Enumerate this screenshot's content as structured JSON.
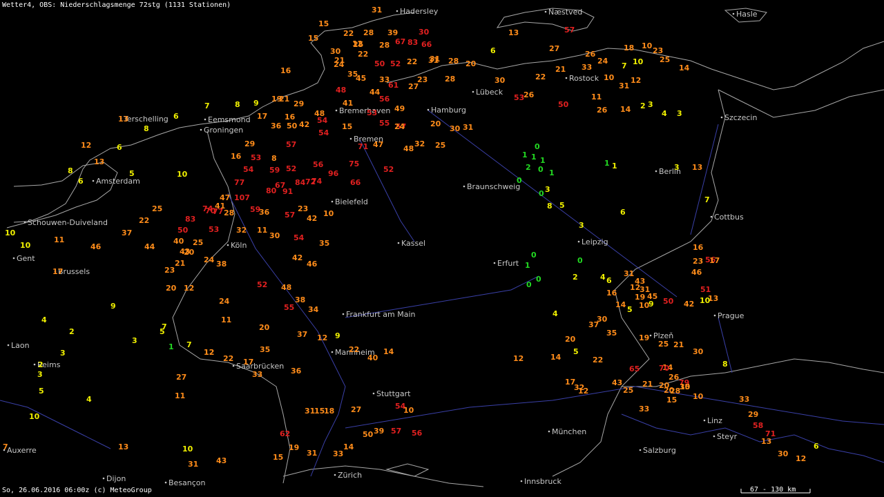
{
  "header": {
    "title": "Wetter4, OBS: Niederschlagsmenge 72stg (1131 Stationen)"
  },
  "footer": {
    "caption": "So, 26.06.2016 06:00z (c) MeteoGroup",
    "scale": "67 - 130 km"
  },
  "colors": {
    "background": "#000000",
    "borders": "#a8a8a8",
    "rivers": "#3a40a8",
    "city_label": "#c8c8c8",
    "class_green": "#22d822",
    "class_yellow": "#f0f000",
    "class_orange": "#ff8c1a",
    "class_red": "#e02020"
  },
  "cities": [
    {
      "name": "Hadersley"
    },
    {
      "name": "Næstved"
    },
    {
      "name": "Hasle"
    },
    {
      "name": "Rostock"
    },
    {
      "name": "Lübeck"
    },
    {
      "name": "Hamburg"
    },
    {
      "name": "Bremerhaven"
    },
    {
      "name": "Bremen"
    },
    {
      "name": "Szczecin"
    },
    {
      "name": "Terschelling"
    },
    {
      "name": "Eemsmond"
    },
    {
      "name": "Groningen"
    },
    {
      "name": "Amsterdam"
    },
    {
      "name": "Berlin"
    },
    {
      "name": "Braunschweig"
    },
    {
      "name": "Bielefeld"
    },
    {
      "name": "Schouwen-Duiveland"
    },
    {
      "name": "Cottbus"
    },
    {
      "name": "Kassel"
    },
    {
      "name": "Leipzig"
    },
    {
      "name": "Köln"
    },
    {
      "name": "Gent"
    },
    {
      "name": "Brussels"
    },
    {
      "name": "Erfurt"
    },
    {
      "name": "Frankfurt am Main"
    },
    {
      "name": "Prague"
    },
    {
      "name": "Laon"
    },
    {
      "name": "Plzeň"
    },
    {
      "name": "Mannheim"
    },
    {
      "name": "Saarbrücken"
    },
    {
      "name": "Reims"
    },
    {
      "name": "Stuttgart"
    },
    {
      "name": "Linz"
    },
    {
      "name": "München"
    },
    {
      "name": "Steyr"
    },
    {
      "name": "Auxerre"
    },
    {
      "name": "Salzburg"
    },
    {
      "name": "Dijon"
    },
    {
      "name": "Besançon"
    },
    {
      "name": "Zürich"
    },
    {
      "name": "Innsbruck"
    }
  ],
  "observations": [
    {
      "v": "31",
      "c": "o"
    },
    {
      "v": "15",
      "c": "o"
    },
    {
      "v": "22",
      "c": "o"
    },
    {
      "v": "28",
      "c": "o"
    },
    {
      "v": "39",
      "c": "o"
    },
    {
      "v": "30",
      "c": "r"
    },
    {
      "v": "57",
      "c": "r"
    },
    {
      "v": "13",
      "c": "o"
    },
    {
      "v": "15",
      "c": "o"
    },
    {
      "v": "12",
      "c": "o"
    },
    {
      "v": "25",
      "c": "o"
    },
    {
      "v": "28",
      "c": "o"
    },
    {
      "v": "67",
      "c": "r"
    },
    {
      "v": "83",
      "c": "r"
    },
    {
      "v": "66",
      "c": "r"
    },
    {
      "v": "27",
      "c": "o"
    },
    {
      "v": "30",
      "c": "o"
    },
    {
      "v": "21",
      "c": "o"
    },
    {
      "v": "22",
      "c": "o"
    },
    {
      "v": "26",
      "c": "o"
    },
    {
      "v": "18",
      "c": "o"
    },
    {
      "v": "10",
      "c": "o"
    },
    {
      "v": "23",
      "c": "o"
    },
    {
      "v": "6",
      "c": "y"
    },
    {
      "v": "24",
      "c": "o"
    },
    {
      "v": "31",
      "c": "o"
    },
    {
      "v": "50",
      "c": "r"
    },
    {
      "v": "52",
      "c": "r"
    },
    {
      "v": "22",
      "c": "o"
    },
    {
      "v": "31",
      "c": "o"
    },
    {
      "v": "28",
      "c": "o"
    },
    {
      "v": "20",
      "c": "o"
    },
    {
      "v": "16",
      "c": "o"
    },
    {
      "v": "35",
      "c": "o"
    },
    {
      "v": "45",
      "c": "o"
    },
    {
      "v": "33",
      "c": "o"
    },
    {
      "v": "61",
      "c": "r"
    },
    {
      "v": "27",
      "c": "o"
    },
    {
      "v": "23",
      "c": "o"
    },
    {
      "v": "28",
      "c": "o"
    },
    {
      "v": "30",
      "c": "o"
    },
    {
      "v": "22",
      "c": "o"
    },
    {
      "v": "21",
      "c": "o"
    },
    {
      "v": "33",
      "c": "o"
    },
    {
      "v": "24",
      "c": "o"
    },
    {
      "v": "7",
      "c": "y"
    },
    {
      "v": "10",
      "c": "y"
    },
    {
      "v": "25",
      "c": "o"
    },
    {
      "v": "14",
      "c": "o"
    },
    {
      "v": "48",
      "c": "r"
    },
    {
      "v": "44",
      "c": "o"
    },
    {
      "v": "56",
      "c": "r"
    },
    {
      "v": "53",
      "c": "r"
    },
    {
      "v": "26",
      "c": "o"
    },
    {
      "v": "50",
      "c": "r"
    },
    {
      "v": "10",
      "c": "o"
    },
    {
      "v": "31",
      "c": "o"
    },
    {
      "v": "12",
      "c": "o"
    },
    {
      "v": "7",
      "c": "y"
    },
    {
      "v": "8",
      "c": "y"
    },
    {
      "v": "9",
      "c": "y"
    },
    {
      "v": "19",
      "c": "o"
    },
    {
      "v": "21",
      "c": "o"
    },
    {
      "v": "29",
      "c": "o"
    },
    {
      "v": "48",
      "c": "o"
    },
    {
      "v": "41",
      "c": "o"
    },
    {
      "v": "49",
      "c": "o"
    },
    {
      "v": "11",
      "c": "o"
    },
    {
      "v": "26",
      "c": "o"
    },
    {
      "v": "14",
      "c": "o"
    },
    {
      "v": "2",
      "c": "y"
    },
    {
      "v": "3",
      "c": "y"
    },
    {
      "v": "4",
      "c": "y"
    },
    {
      "v": "3",
      "c": "y"
    },
    {
      "v": "13",
      "c": "o"
    },
    {
      "v": "6",
      "c": "y"
    },
    {
      "v": "17",
      "c": "o"
    },
    {
      "v": "16",
      "c": "o"
    },
    {
      "v": "54",
      "c": "r"
    },
    {
      "v": "53",
      "c": "r"
    },
    {
      "v": "55",
      "c": "r"
    },
    {
      "v": "57",
      "c": "r"
    },
    {
      "v": "8",
      "c": "y"
    },
    {
      "v": "36",
      "c": "o"
    },
    {
      "v": "50",
      "c": "o"
    },
    {
      "v": "42",
      "c": "o"
    },
    {
      "v": "15",
      "c": "o"
    },
    {
      "v": "24",
      "c": "o"
    },
    {
      "v": "20",
      "c": "o"
    },
    {
      "v": "30",
      "c": "o"
    },
    {
      "v": "31",
      "c": "o"
    },
    {
      "v": "12",
      "c": "o"
    },
    {
      "v": "29",
      "c": "o"
    },
    {
      "v": "57",
      "c": "r"
    },
    {
      "v": "54",
      "c": "r"
    },
    {
      "v": "71",
      "c": "r"
    },
    {
      "v": "47",
      "c": "o"
    },
    {
      "v": "48",
      "c": "o"
    },
    {
      "v": "32",
      "c": "o"
    },
    {
      "v": "25",
      "c": "o"
    },
    {
      "v": "6",
      "c": "y"
    },
    {
      "v": "13",
      "c": "o"
    },
    {
      "v": "53",
      "c": "r"
    },
    {
      "v": "16",
      "c": "o"
    },
    {
      "v": "8",
      "c": "o"
    },
    {
      "v": "56",
      "c": "r"
    },
    {
      "v": "75",
      "c": "r"
    },
    {
      "v": "52",
      "c": "r"
    },
    {
      "v": "8",
      "c": "y"
    },
    {
      "v": "6",
      "c": "y"
    },
    {
      "v": "5",
      "c": "y"
    },
    {
      "v": "54",
      "c": "r"
    },
    {
      "v": "59",
      "c": "r"
    },
    {
      "v": "52",
      "c": "r"
    },
    {
      "v": "74",
      "c": "r"
    },
    {
      "v": "96",
      "c": "r"
    },
    {
      "v": "10",
      "c": "y"
    },
    {
      "v": "77",
      "c": "r"
    },
    {
      "v": "67",
      "c": "r"
    },
    {
      "v": "84",
      "c": "r"
    },
    {
      "v": "72",
      "c": "r"
    },
    {
      "v": "66",
      "c": "r"
    },
    {
      "v": "0",
      "c": "g"
    },
    {
      "v": "1",
      "c": "g"
    },
    {
      "v": "1",
      "c": "g"
    },
    {
      "v": "2",
      "c": "g"
    },
    {
      "v": "0",
      "c": "g"
    },
    {
      "v": "0",
      "c": "g"
    },
    {
      "v": "1",
      "c": "g"
    },
    {
      "v": "1",
      "c": "y"
    },
    {
      "v": "3",
      "c": "y"
    },
    {
      "v": "13",
      "c": "o"
    },
    {
      "v": "7",
      "c": "y"
    },
    {
      "v": "47",
      "c": "o"
    },
    {
      "v": "107",
      "c": "r"
    },
    {
      "v": "80",
      "c": "r"
    },
    {
      "v": "91",
      "c": "r"
    },
    {
      "v": "25",
      "c": "o"
    },
    {
      "v": "74",
      "c": "r"
    },
    {
      "v": "77",
      "c": "r"
    },
    {
      "v": "59",
      "c": "r"
    },
    {
      "v": "36",
      "c": "o"
    },
    {
      "v": "41",
      "c": "o"
    },
    {
      "v": "23",
      "c": "o"
    },
    {
      "v": "22",
      "c": "o"
    },
    {
      "v": "83",
      "c": "r"
    },
    {
      "v": "70",
      "c": "r"
    },
    {
      "v": "28",
      "c": "o"
    },
    {
      "v": "57",
      "c": "r"
    },
    {
      "v": "42",
      "c": "o"
    },
    {
      "v": "10",
      "c": "o"
    },
    {
      "v": "10",
      "c": "y"
    },
    {
      "v": "11",
      "c": "o"
    },
    {
      "v": "37",
      "c": "o"
    },
    {
      "v": "50",
      "c": "r"
    },
    {
      "v": "53",
      "c": "r"
    },
    {
      "v": "32",
      "c": "o"
    },
    {
      "v": "11",
      "c": "o"
    },
    {
      "v": "30",
      "c": "o"
    },
    {
      "v": "10",
      "c": "y"
    },
    {
      "v": "46",
      "c": "o"
    },
    {
      "v": "44",
      "c": "o"
    },
    {
      "v": "40",
      "c": "o"
    },
    {
      "v": "43",
      "c": "o"
    },
    {
      "v": "25",
      "c": "o"
    },
    {
      "v": "54",
      "c": "r"
    },
    {
      "v": "35",
      "c": "o"
    },
    {
      "v": "17",
      "c": "o"
    },
    {
      "v": "23",
      "c": "o"
    },
    {
      "v": "21",
      "c": "o"
    },
    {
      "v": "20",
      "c": "o"
    },
    {
      "v": "24",
      "c": "o"
    },
    {
      "v": "38",
      "c": "o"
    },
    {
      "v": "42",
      "c": "o"
    },
    {
      "v": "46",
      "c": "o"
    },
    {
      "v": "20",
      "c": "o"
    },
    {
      "v": "12",
      "c": "o"
    },
    {
      "v": "52",
      "c": "r"
    },
    {
      "v": "24",
      "c": "o"
    },
    {
      "v": "48",
      "c": "o"
    },
    {
      "v": "38",
      "c": "o"
    },
    {
      "v": "34",
      "c": "o"
    },
    {
      "v": "55",
      "c": "r"
    },
    {
      "v": "4",
      "c": "y"
    },
    {
      "v": "9",
      "c": "y"
    },
    {
      "v": "11",
      "c": "o"
    },
    {
      "v": "20",
      "c": "o"
    },
    {
      "v": "35",
      "c": "o"
    },
    {
      "v": "37",
      "c": "o"
    },
    {
      "v": "12",
      "c": "o"
    },
    {
      "v": "2",
      "c": "y"
    },
    {
      "v": "3",
      "c": "y"
    },
    {
      "v": "7",
      "c": "y"
    },
    {
      "v": "1",
      "c": "g"
    },
    {
      "v": "7",
      "c": "y"
    },
    {
      "v": "12",
      "c": "o"
    },
    {
      "v": "22",
      "c": "o"
    },
    {
      "v": "17",
      "c": "o"
    },
    {
      "v": "3",
      "c": "y"
    },
    {
      "v": "2",
      "c": "y"
    },
    {
      "v": "3",
      "c": "y"
    },
    {
      "v": "5",
      "c": "y"
    },
    {
      "v": "27",
      "c": "o"
    },
    {
      "v": "11",
      "c": "o"
    },
    {
      "v": "33",
      "c": "o"
    },
    {
      "v": "36",
      "c": "o"
    },
    {
      "v": "10",
      "c": "y"
    },
    {
      "v": "4",
      "c": "y"
    },
    {
      "v": "13",
      "c": "o"
    },
    {
      "v": "10",
      "c": "y"
    },
    {
      "v": "31",
      "c": "o"
    },
    {
      "v": "43",
      "c": "o"
    },
    {
      "v": "15",
      "c": "o"
    },
    {
      "v": "7",
      "c": "o"
    },
    {
      "v": "12",
      "c": "o"
    },
    {
      "v": "5",
      "c": "y"
    },
    {
      "v": "9",
      "c": "y"
    },
    {
      "v": "22",
      "c": "o"
    },
    {
      "v": "40",
      "c": "o"
    },
    {
      "v": "14",
      "c": "o"
    },
    {
      "v": "31",
      "c": "o"
    },
    {
      "v": "15",
      "c": "o"
    },
    {
      "v": "18",
      "c": "o"
    },
    {
      "v": "27",
      "c": "o"
    },
    {
      "v": "54",
      "c": "r"
    },
    {
      "v": "10",
      "c": "o"
    },
    {
      "v": "56",
      "c": "r"
    },
    {
      "v": "62",
      "c": "r"
    },
    {
      "v": "19",
      "c": "o"
    },
    {
      "v": "31",
      "c": "o"
    },
    {
      "v": "33",
      "c": "o"
    },
    {
      "v": "14",
      "c": "o"
    },
    {
      "v": "50",
      "c": "o"
    },
    {
      "v": "39",
      "c": "o"
    },
    {
      "v": "57",
      "c": "r"
    },
    {
      "v": "1",
      "c": "g"
    },
    {
      "v": "0",
      "c": "g"
    },
    {
      "v": "1",
      "c": "g"
    },
    {
      "v": "3",
      "c": "y"
    },
    {
      "v": "8",
      "c": "y"
    },
    {
      "v": "5",
      "c": "y"
    },
    {
      "v": "3",
      "c": "y"
    },
    {
      "v": "6",
      "c": "y"
    },
    {
      "v": "0",
      "c": "g"
    },
    {
      "v": "0",
      "c": "g"
    },
    {
      "v": "1",
      "c": "g"
    },
    {
      "v": "0",
      "c": "g"
    },
    {
      "v": "0",
      "c": "g"
    },
    {
      "v": "2",
      "c": "y"
    },
    {
      "v": "4",
      "c": "y"
    },
    {
      "v": "6",
      "c": "y"
    },
    {
      "v": "4",
      "c": "y"
    },
    {
      "v": "12",
      "c": "o"
    },
    {
      "v": "14",
      "c": "o"
    },
    {
      "v": "5",
      "c": "y"
    },
    {
      "v": "20",
      "c": "o"
    },
    {
      "v": "22",
      "c": "o"
    },
    {
      "v": "17",
      "c": "o"
    },
    {
      "v": "32",
      "c": "o"
    },
    {
      "v": "12",
      "c": "o"
    },
    {
      "v": "43",
      "c": "o"
    },
    {
      "v": "21",
      "c": "o"
    },
    {
      "v": "14",
      "c": "o"
    },
    {
      "v": "15",
      "c": "o"
    },
    {
      "v": "10",
      "c": "o"
    },
    {
      "v": "28",
      "c": "o"
    },
    {
      "v": "79",
      "c": "r"
    },
    {
      "v": "25",
      "c": "o"
    },
    {
      "v": "33",
      "c": "o"
    },
    {
      "v": "20",
      "c": "o"
    },
    {
      "v": "15",
      "c": "o"
    },
    {
      "v": "20",
      "c": "o"
    },
    {
      "v": "65",
      "c": "r"
    },
    {
      "v": "70",
      "c": "r"
    },
    {
      "v": "26",
      "c": "o"
    },
    {
      "v": "30",
      "c": "o"
    },
    {
      "v": "46",
      "c": "o"
    },
    {
      "v": "51",
      "c": "r"
    },
    {
      "v": "13",
      "c": "o"
    },
    {
      "v": "16",
      "c": "o"
    },
    {
      "v": "23",
      "c": "o"
    },
    {
      "v": "56",
      "c": "r"
    },
    {
      "v": "17",
      "c": "o"
    },
    {
      "v": "31",
      "c": "o"
    },
    {
      "v": "43",
      "c": "o"
    },
    {
      "v": "31",
      "c": "o"
    },
    {
      "v": "45",
      "c": "o"
    },
    {
      "v": "50",
      "c": "r"
    },
    {
      "v": "42",
      "c": "o"
    },
    {
      "v": "10",
      "c": "y"
    },
    {
      "v": "16",
      "c": "o"
    },
    {
      "v": "14",
      "c": "o"
    },
    {
      "v": "5",
      "c": "y"
    },
    {
      "v": "12",
      "c": "o"
    },
    {
      "v": "19",
      "c": "o"
    },
    {
      "v": "10",
      "c": "o"
    },
    {
      "v": "9",
      "c": "y"
    },
    {
      "v": "30",
      "c": "o"
    },
    {
      "v": "37",
      "c": "o"
    },
    {
      "v": "35",
      "c": "o"
    },
    {
      "v": "19",
      "c": "o"
    },
    {
      "v": "25",
      "c": "o"
    },
    {
      "v": "21",
      "c": "o"
    },
    {
      "v": "30",
      "c": "o"
    },
    {
      "v": "8",
      "c": "y"
    },
    {
      "v": "33",
      "c": "o"
    },
    {
      "v": "29",
      "c": "o"
    },
    {
      "v": "58",
      "c": "r"
    },
    {
      "v": "71",
      "c": "r"
    },
    {
      "v": "13",
      "c": "o"
    },
    {
      "v": "30",
      "c": "o"
    },
    {
      "v": "12",
      "c": "o"
    },
    {
      "v": "6",
      "c": "y"
    }
  ]
}
